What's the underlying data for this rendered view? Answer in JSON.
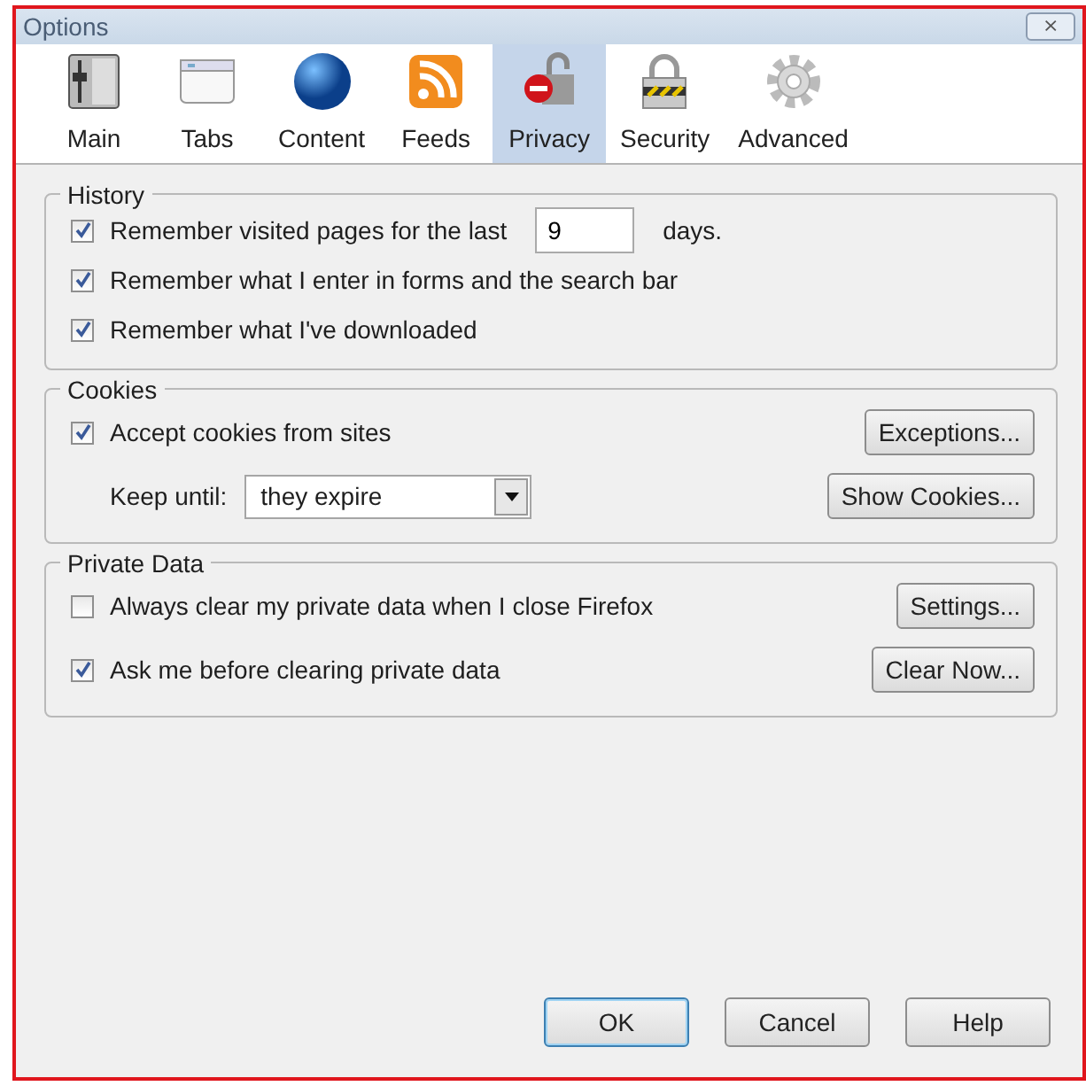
{
  "window": {
    "title": "Options",
    "close": "⨯"
  },
  "tabs": [
    {
      "label": "Main",
      "selected": false
    },
    {
      "label": "Tabs",
      "selected": false
    },
    {
      "label": "Content",
      "selected": false
    },
    {
      "label": "Feeds",
      "selected": false
    },
    {
      "label": "Privacy",
      "selected": true
    },
    {
      "label": "Security",
      "selected": false
    },
    {
      "label": "Advanced",
      "selected": false
    }
  ],
  "sections": [
    {
      "title": "History",
      "rows": [
        {
          "kind": "checkbox",
          "label": "Remember visited pages for the last",
          "checked": true,
          "field": {
            "value": "9"
          },
          "suffix": "days."
        },
        {
          "kind": "checkbox",
          "label": "Remember what I enter in forms and the search bar",
          "checked": true
        },
        {
          "kind": "checkbox",
          "label": "Remember what I've downloaded",
          "checked": true
        }
      ]
    },
    {
      "title": "Cookies",
      "rows": [
        {
          "kind": "checkbox",
          "label": "Accept cookies from sites",
          "checked": true,
          "button": "Exceptions..."
        },
        {
          "kind": "select",
          "label": "Keep until:",
          "value": "they expire",
          "button": "Show Cookies..."
        }
      ]
    },
    {
      "title": "Private Data",
      "rows": [
        {
          "kind": "checkbox",
          "label": "Always clear my private data when I close Firefox",
          "checked": false,
          "button": "Settings..."
        },
        {
          "kind": "checkbox",
          "label": "Ask me before clearing private data",
          "checked": true,
          "button": "Clear Now..."
        }
      ]
    }
  ],
  "buttons": [
    {
      "label": "OK",
      "default": true
    },
    {
      "label": "Cancel",
      "default": false
    },
    {
      "label": "Help",
      "default": false
    }
  ]
}
